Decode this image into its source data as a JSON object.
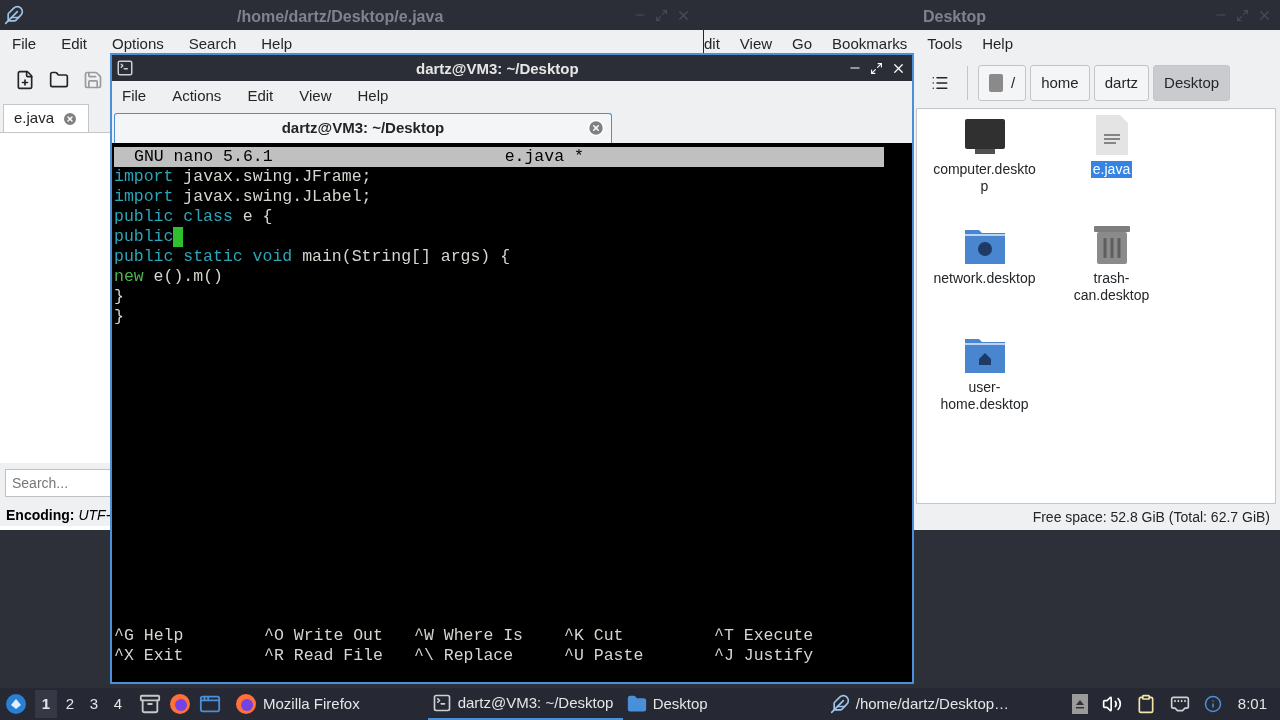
{
  "editor_window": {
    "title": "/home/dartz/Desktop/e.java",
    "menu": [
      "File",
      "Edit",
      "Options",
      "Search",
      "Help"
    ],
    "toolbar": [
      {
        "kind": "new-file",
        "disabled": false
      },
      {
        "kind": "open",
        "disabled": false
      },
      {
        "kind": "save",
        "disabled": true
      }
    ],
    "tab": {
      "label": "e.java"
    },
    "search": {
      "placeholder": "Search..."
    },
    "encoding": {
      "label": "Encoding:",
      "value": "UTF-"
    }
  },
  "file_manager": {
    "title": "Desktop",
    "menu": [
      "dit",
      "View",
      "Go",
      "Bookmarks",
      "Tools",
      "Help"
    ],
    "path": [
      {
        "kind": "root",
        "label": "/",
        "selected": false
      },
      {
        "kind": "dir",
        "label": "home",
        "selected": false
      },
      {
        "kind": "dir",
        "label": "dartz",
        "selected": false
      },
      {
        "kind": "dir",
        "label": "Desktop",
        "selected": true
      }
    ],
    "files": [
      {
        "kind": "computer",
        "name": "computer.desktop",
        "selected": false
      },
      {
        "kind": "text",
        "name": "e.java",
        "selected": true
      },
      {
        "kind": "network",
        "name": "network.desktop",
        "selected": false
      },
      {
        "kind": "trash",
        "name": "trash-can.desktop",
        "selected": false
      },
      {
        "kind": "home",
        "name": "user-home.desktop",
        "selected": false
      }
    ],
    "status": "Free space: 52.8 GiB (Total: 62.7 GiB)"
  },
  "terminal": {
    "title": "dartz@VM3: ~/Desktop",
    "menu": [
      "File",
      "Actions",
      "Edit",
      "View",
      "Help"
    ],
    "tab": {
      "label": "dartz@VM3: ~/Desktop"
    },
    "nano": {
      "version": "GNU nano 5.6.1",
      "filename": "e.java *",
      "lines": [
        {
          "cursor": false,
          "tokens": [
            {
              "kind": "keyword",
              "text": "import"
            },
            {
              "kind": "plain",
              "text": " javax.swing.JFrame;"
            }
          ]
        },
        {
          "cursor": false,
          "tokens": [
            {
              "kind": "keyword",
              "text": "import"
            },
            {
              "kind": "plain",
              "text": " javax.swing.JLabel;"
            }
          ]
        },
        {
          "cursor": false,
          "tokens": [
            {
              "kind": "keyword",
              "text": "public class"
            },
            {
              "kind": "plain",
              "text": " e {"
            }
          ]
        },
        {
          "cursor": true,
          "tokens": [
            {
              "kind": "keyword",
              "text": "public"
            }
          ]
        },
        {
          "cursor": false,
          "tokens": [
            {
              "kind": "keyword",
              "text": "public static void"
            },
            {
              "kind": "plain",
              "text": " main(String[] args) {"
            }
          ]
        },
        {
          "cursor": false,
          "tokens": [
            {
              "kind": "operator",
              "text": "new"
            },
            {
              "kind": "plain",
              "text": " e().m()"
            }
          ]
        },
        {
          "cursor": false,
          "tokens": [
            {
              "kind": "plain",
              "text": "}"
            }
          ]
        },
        {
          "cursor": false,
          "tokens": [
            {
              "kind": "plain",
              "text": "}"
            }
          ]
        }
      ],
      "shortcuts": [
        [
          {
            "key": "^G",
            "label": "Help"
          },
          {
            "key": "^O",
            "label": "Write Out"
          },
          {
            "key": "^W",
            "label": "Where Is"
          },
          {
            "key": "^K",
            "label": "Cut"
          },
          {
            "key": "^T",
            "label": "Execute"
          }
        ],
        [
          {
            "key": "^X",
            "label": "Exit"
          },
          {
            "key": "^R",
            "label": "Read File"
          },
          {
            "key": "^\\",
            "label": "Replace"
          },
          {
            "key": "^U",
            "label": "Paste"
          },
          {
            "key": "^J",
            "label": "Justify"
          }
        ]
      ]
    }
  },
  "taskbar": {
    "desktops": [
      {
        "label": "1",
        "selected": true
      },
      {
        "label": "2",
        "selected": false
      },
      {
        "label": "3",
        "selected": false
      },
      {
        "label": "4",
        "selected": false
      }
    ],
    "launchers": [
      {
        "kind": "files"
      },
      {
        "kind": "browser"
      },
      {
        "kind": "desktop"
      }
    ],
    "tasks": [
      {
        "kind": "browser",
        "label": "Mozilla Firefox",
        "selected": false
      },
      {
        "kind": "terminal",
        "label": "dartz@VM3: ~/Desktop",
        "selected": true
      },
      {
        "kind": "folder",
        "label": "Desktop",
        "selected": false
      },
      {
        "kind": "editor",
        "label": "/home/dartz/Desktop…",
        "selected": false
      }
    ],
    "tray": [
      {
        "kind": "eject"
      },
      {
        "kind": "volume"
      },
      {
        "kind": "clipboard"
      },
      {
        "kind": "network"
      },
      {
        "kind": "notification"
      }
    ],
    "clock": "8:01"
  }
}
